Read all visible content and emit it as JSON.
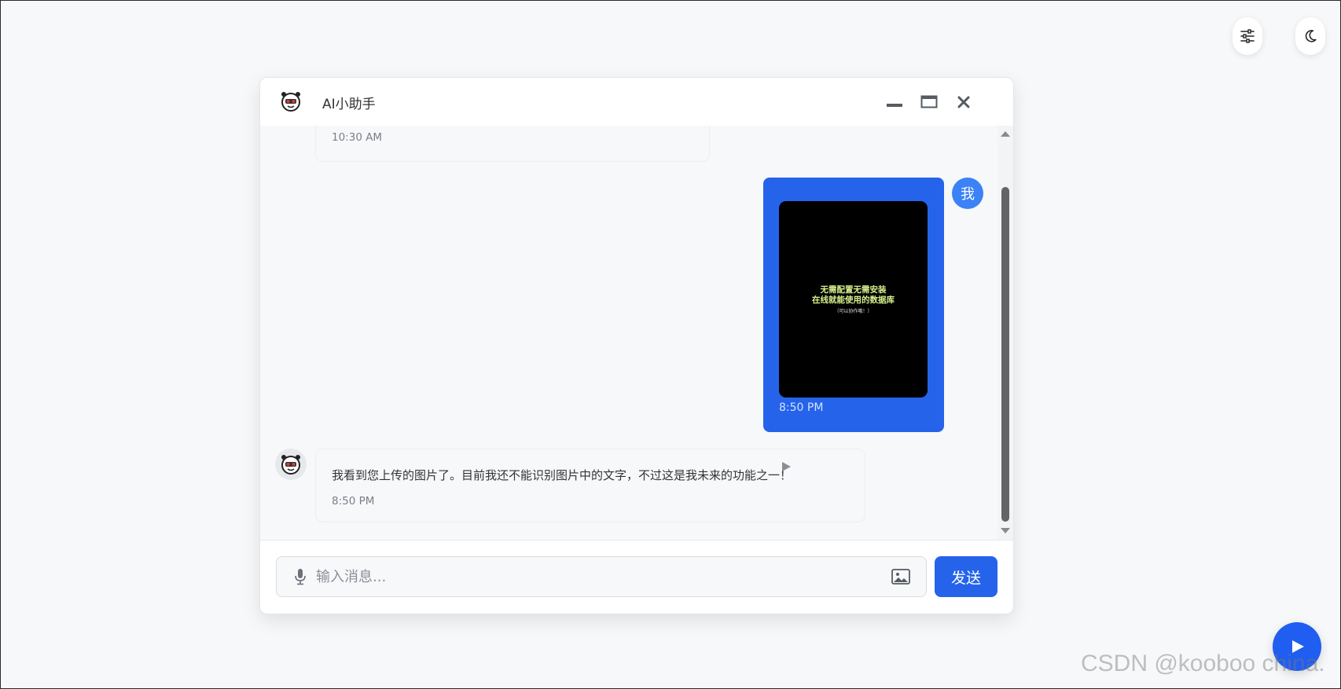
{
  "header": {
    "title": "AI小助手",
    "logo_icon": "robot-icon",
    "controls": [
      "minimize-icon",
      "maximize-icon",
      "close-icon"
    ]
  },
  "top_buttons": [
    "sliders-icon",
    "moon-icon"
  ],
  "messages": [
    {
      "role": "assistant",
      "text": "",
      "time": "10:30 AM"
    },
    {
      "role": "user",
      "avatar_label": "我",
      "image_text": [
        "无需配置无需安装",
        "在线就能使用的数据库",
        "（可以协作哦！）"
      ],
      "time": "8:50 PM"
    },
    {
      "role": "assistant",
      "text": "我看到您上传的图片了。目前我还不能识别图片中的文字，不过这是我未来的功能之一！",
      "time": "8:50 PM"
    }
  ],
  "input": {
    "placeholder": "输入消息...",
    "value": ""
  },
  "send_button": "发送",
  "watermark": "CSDN @kooboo china.",
  "colors": {
    "accent": "#2563eb",
    "background": "#f7f8fa"
  }
}
